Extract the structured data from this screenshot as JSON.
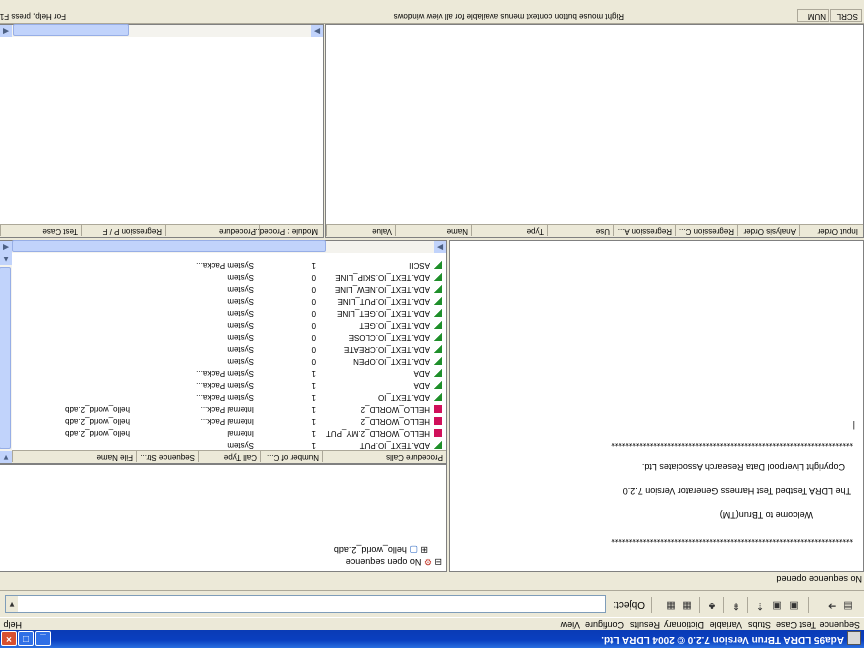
{
  "window": {
    "title": "Ada95 LDRA TBrun Version 7.2.0 © 2004 LDRA Ltd."
  },
  "menu": {
    "items": [
      "Sequence",
      "Test Case",
      "Stubs",
      "Variable",
      "Dictionary",
      "Results",
      "Configure",
      "View"
    ],
    "help": "Help"
  },
  "toolbar": {
    "object_label": "Object:",
    "object_value": ""
  },
  "sequence_status": "No sequence opened",
  "tree": {
    "root": "No open sequence",
    "child": "hello_world_2.adb"
  },
  "welcome": {
    "stars": "*********************************************************************",
    "line1": "Welcome to TBrun(TM)",
    "line2": "The LDRA Testbed Test Harness Generator Version 7.2.0",
    "line3": "Copyright Liverpool Data Research Associates Ltd.",
    "prompt": "|"
  },
  "procedure_calls": {
    "columns": [
      "Procedure Calls",
      "Number of C...",
      "Call Type",
      "Sequence Str...",
      "File Name"
    ],
    "rows": [
      {
        "flag": "green",
        "name": "ADA.TEXT_IO.PUT",
        "calls": "1",
        "type": "System",
        "seq": "",
        "file": ""
      },
      {
        "flag": "red",
        "name": "HELLO_WORLD_2.MY_PUT",
        "calls": "1",
        "type": "Internal",
        "seq": "",
        "file": "hello_world_2.adb"
      },
      {
        "flag": "red",
        "name": "HELLO_WORLD_2",
        "calls": "1",
        "type": "Internal Pack...",
        "seq": "",
        "file": "hello_world_2.adb"
      },
      {
        "flag": "red",
        "name": "HELLO_WORLD_2",
        "calls": "1",
        "type": "Internal Pack...",
        "seq": "",
        "file": "hello_world_2.adb"
      },
      {
        "flag": "green",
        "name": "ADA.TEXT_IO",
        "calls": "1",
        "type": "System Packa...",
        "seq": "",
        "file": ""
      },
      {
        "flag": "green",
        "name": "ADA",
        "calls": "1",
        "type": "System Packa...",
        "seq": "",
        "file": ""
      },
      {
        "flag": "green",
        "name": "ADA",
        "calls": "1",
        "type": "System Packa...",
        "seq": "",
        "file": ""
      },
      {
        "flag": "green",
        "name": "ADA.TEXT_IO.OPEN",
        "calls": "0",
        "type": "System",
        "seq": "",
        "file": ""
      },
      {
        "flag": "green",
        "name": "ADA.TEXT_IO.CREATE",
        "calls": "0",
        "type": "System",
        "seq": "",
        "file": ""
      },
      {
        "flag": "green",
        "name": "ADA.TEXT_IO.CLOSE",
        "calls": "0",
        "type": "System",
        "seq": "",
        "file": ""
      },
      {
        "flag": "green",
        "name": "ADA.TEXT_IO.GET",
        "calls": "0",
        "type": "System",
        "seq": "",
        "file": ""
      },
      {
        "flag": "green",
        "name": "ADA.TEXT_IO.GET_LINE",
        "calls": "0",
        "type": "System",
        "seq": "",
        "file": ""
      },
      {
        "flag": "green",
        "name": "ADA.TEXT_IO.PUT_LINE",
        "calls": "0",
        "type": "System",
        "seq": "",
        "file": ""
      },
      {
        "flag": "green",
        "name": "ADA.TEXT_IO.NEW_LINE",
        "calls": "0",
        "type": "System",
        "seq": "",
        "file": ""
      },
      {
        "flag": "green",
        "name": "ADA.TEXT_IO.SKIP_LINE",
        "calls": "0",
        "type": "System",
        "seq": "",
        "file": ""
      },
      {
        "flag": "green",
        "name": "ASCII",
        "calls": "1",
        "type": "System Packa...",
        "seq": "",
        "file": ""
      }
    ]
  },
  "test_cases": {
    "columns": [
      "Test Case",
      "Regression P / F",
      "Procedure",
      "Module : Proced..."
    ]
  },
  "variables": {
    "columns": [
      "Value",
      "Name",
      "Type",
      "Use",
      "Regression A...",
      "Regression C...",
      "Analysis Order",
      "Input Order"
    ]
  },
  "statusbar": {
    "help": "For Help, press F1",
    "hint": "Right mouse button context menus available for all view windows",
    "num": "NUM",
    "scrl": "SCRL"
  }
}
